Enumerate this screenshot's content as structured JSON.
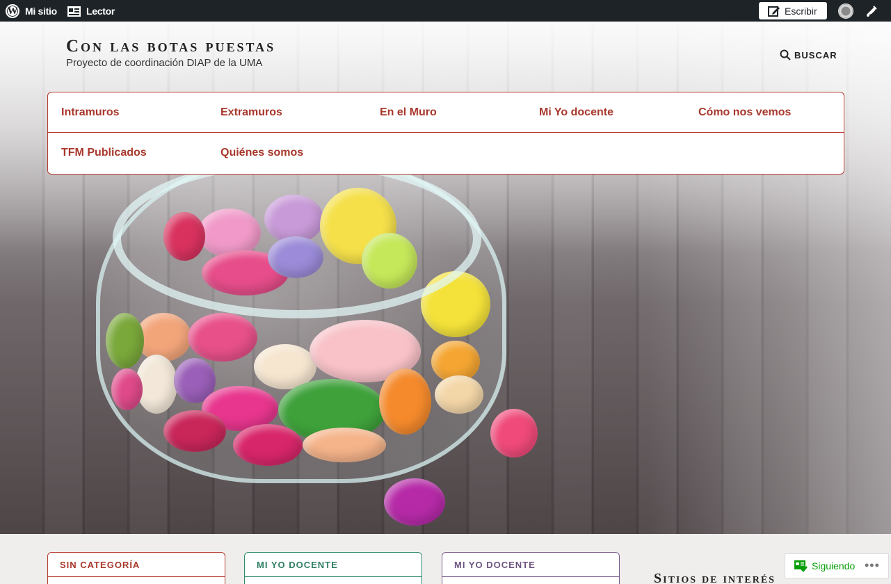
{
  "adminbar": {
    "my_site": "Mi sitio",
    "reader": "Lector",
    "write": "Escribir"
  },
  "site": {
    "title": "Con las botas puestas",
    "tagline": "Proyecto de coordinación DIAP de la UMA",
    "search": "BUSCAR"
  },
  "nav": {
    "items": [
      {
        "label": "Intramuros"
      },
      {
        "label": "Extramuros"
      },
      {
        "label": "En el Muro"
      },
      {
        "label": "Mi Yo docente"
      },
      {
        "label": "Cómo nos vemos"
      },
      {
        "label": "TFM Publicados"
      },
      {
        "label": "Quiénes somos"
      }
    ]
  },
  "cards": [
    {
      "category": "SIN CATEGORÍA"
    },
    {
      "category": "MI YO DOCENTE"
    },
    {
      "category": "MI YO DOCENTE"
    }
  ],
  "sidebar": {
    "widget_title": "Sitios de interés"
  },
  "follow": {
    "label": "Siguiendo",
    "more": "•••"
  },
  "colors": {
    "accent_red": "#a8382c",
    "accent_green": "#2f7e63",
    "accent_purple": "#6d5580",
    "adminbar_bg": "#1d2327"
  }
}
